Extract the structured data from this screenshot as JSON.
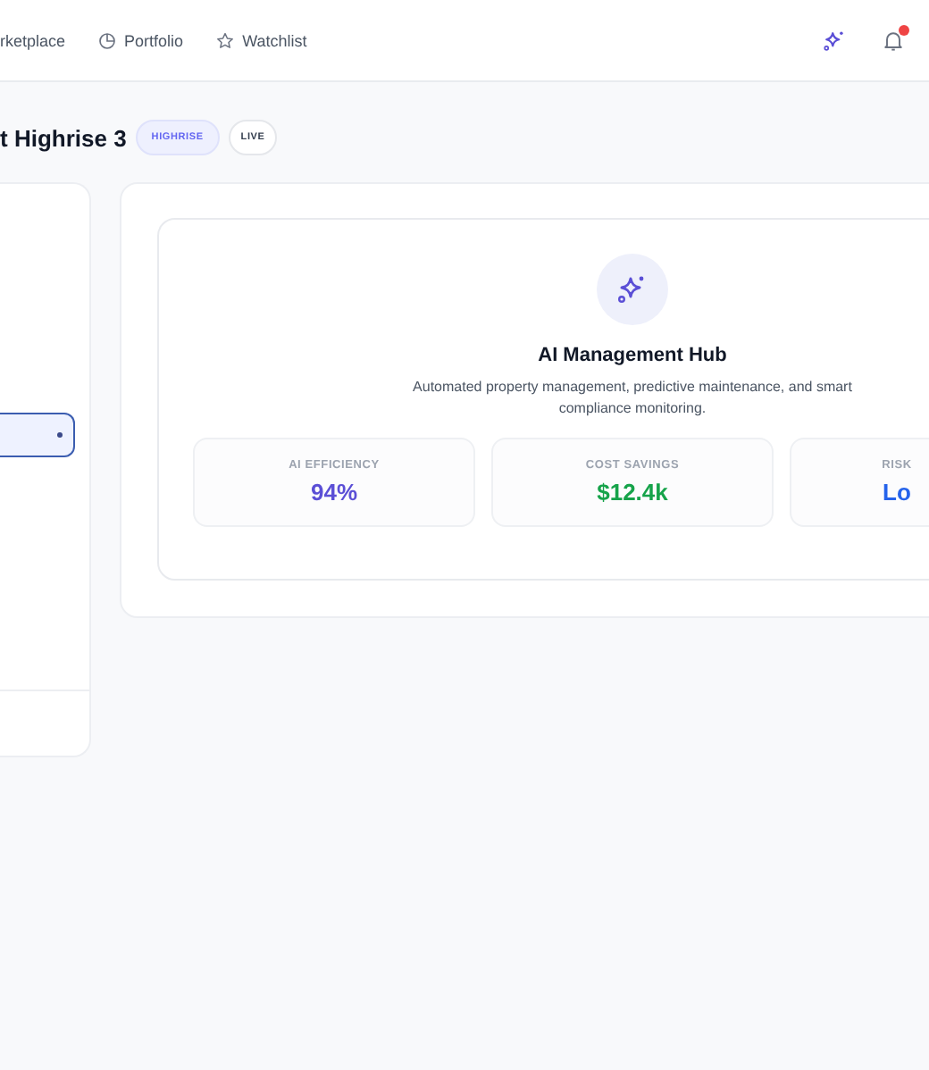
{
  "nav": [
    {
      "label": "rketplace",
      "kind": "plain"
    },
    {
      "label": "Portfolio",
      "kind": "chart"
    },
    {
      "label": "Watchlist",
      "kind": "starred"
    }
  ],
  "header_actions": {
    "notifications_unread": true
  },
  "title": "t Highrise 3",
  "badges": [
    {
      "label": "HIGHRISE",
      "kind": "type"
    },
    {
      "label": "LIVE",
      "kind": "status"
    }
  ],
  "side_panel": {
    "selected_item": {
      "selected": true
    }
  },
  "hub": {
    "title": "AI Management Hub",
    "description": "Automated property management, predictive maintenance, and smart compliance monitoring.",
    "stats": [
      {
        "label": "AI EFFICIENCY",
        "value": "94%",
        "color": "#5b4fd6"
      },
      {
        "label": "COST SAVINGS",
        "value": "$12.4k",
        "color": "#16a34a"
      },
      {
        "label": "RISK",
        "value": "Lo",
        "color": "#2563eb"
      }
    ]
  }
}
